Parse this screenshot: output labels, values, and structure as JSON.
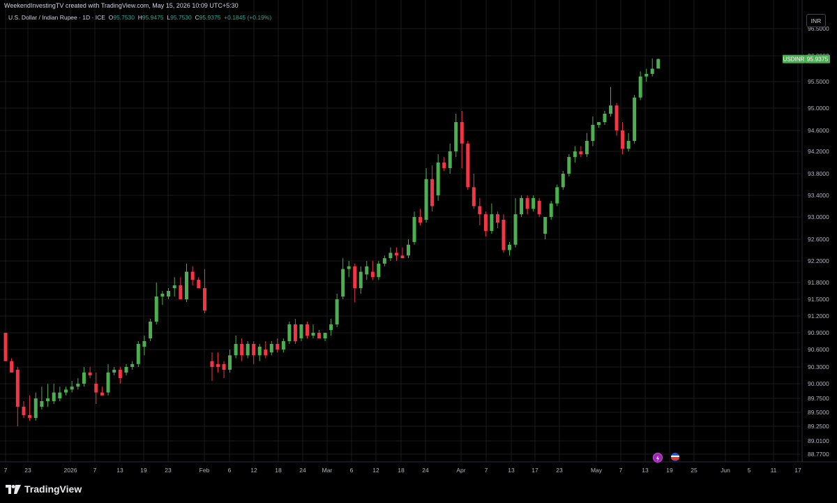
{
  "credit": "WeekendInvestingTV created with TradingView.com, May 15, 2026 10:09 UTC+5:30",
  "legend": {
    "symbol": "U.S. Dollar / Indian Rupee · 1D · ICE",
    "o_label": "O",
    "o": "95.7530",
    "h_label": "H",
    "h": "95.9475",
    "l_label": "L",
    "l": "95.7530",
    "c_label": "C",
    "c": "95.9375",
    "change": "+0.1845 (+0.19%)"
  },
  "currency_button": "INR",
  "brand": "TradingView",
  "colors": {
    "up": "#22ab94",
    "up_fill": "#4caf50",
    "down": "#f23645",
    "grid": "#1a1a1a",
    "axis_text": "#b2b5be",
    "price_tag": "#4caf50"
  },
  "event_icons": [
    "lightning-icon",
    "flag-icon"
  ],
  "chart_data": {
    "type": "candlestick",
    "symbol_tag": "USDINR",
    "last_price": "95.9375",
    "y_ticks": [
      "96.5000",
      "96.0000",
      "95.5000",
      "95.0000",
      "94.6000",
      "94.2000",
      "93.8000",
      "93.4000",
      "93.0000",
      "92.6000",
      "92.2000",
      "91.8000",
      "91.5000",
      "91.2000",
      "90.9000",
      "90.6000",
      "90.3000",
      "90.0000",
      "89.7500",
      "89.5000",
      "89.2500",
      "89.0100",
      "88.7700"
    ],
    "x_ticks": [
      "7",
      "23",
      "2026",
      "7",
      "13",
      "19",
      "23",
      "Feb",
      "6",
      "12",
      "18",
      "24",
      "Mar",
      "6",
      "12",
      "18",
      "24",
      "Apr",
      "7",
      "13",
      "17",
      "23",
      "May",
      "7",
      "13",
      "19",
      "25",
      "Jun",
      "5",
      "11",
      "17"
    ],
    "candles": [
      [
        90.9,
        90.9,
        90.4,
        90.4
      ],
      [
        90.4,
        90.45,
        90.2,
        90.2
      ],
      [
        90.25,
        90.3,
        89.25,
        89.6
      ],
      [
        89.6,
        89.7,
        89.4,
        89.45
      ],
      [
        89.45,
        89.8,
        89.35,
        89.4
      ],
      [
        89.4,
        89.85,
        89.35,
        89.75
      ],
      [
        89.6,
        89.95,
        89.55,
        89.7
      ],
      [
        89.7,
        90.0,
        89.6,
        89.75
      ],
      [
        89.7,
        90.0,
        89.65,
        89.85
      ],
      [
        89.75,
        89.95,
        89.7,
        89.85
      ],
      [
        89.85,
        89.95,
        89.8,
        89.9
      ],
      [
        89.9,
        90.05,
        89.85,
        89.95
      ],
      [
        89.95,
        90.1,
        89.9,
        90.0
      ],
      [
        90.0,
        90.3,
        89.95,
        90.2
      ],
      [
        90.2,
        90.3,
        90.1,
        90.15
      ],
      [
        90.0,
        90.2,
        89.65,
        89.85
      ],
      [
        89.85,
        89.95,
        89.8,
        89.8
      ],
      [
        89.85,
        90.35,
        89.8,
        90.2
      ],
      [
        90.2,
        90.3,
        90.15,
        90.25
      ],
      [
        90.25,
        90.3,
        90.0,
        90.1
      ],
      [
        90.2,
        90.35,
        90.15,
        90.3
      ],
      [
        90.3,
        90.4,
        90.25,
        90.35
      ],
      [
        90.35,
        90.75,
        90.3,
        90.7
      ],
      [
        90.65,
        90.85,
        90.5,
        90.75
      ],
      [
        90.8,
        91.15,
        90.75,
        91.1
      ],
      [
        91.1,
        91.8,
        91.05,
        91.55
      ],
      [
        91.55,
        91.65,
        91.4,
        91.6
      ],
      [
        91.55,
        91.7,
        91.5,
        91.65
      ],
      [
        91.7,
        91.9,
        91.55,
        91.75
      ],
      [
        91.75,
        91.9,
        91.6,
        91.5
      ],
      [
        91.5,
        92.15,
        91.45,
        92.0
      ],
      [
        92.0,
        92.1,
        91.75,
        91.85
      ],
      [
        91.85,
        91.9,
        91.7,
        91.7
      ],
      [
        91.7,
        92.05,
        91.25,
        91.3
      ],
      [
        90.4,
        90.55,
        90.05,
        90.3
      ],
      [
        90.35,
        90.55,
        90.2,
        90.3
      ],
      [
        90.35,
        90.4,
        90.1,
        90.25
      ],
      [
        90.25,
        90.6,
        90.2,
        90.5
      ],
      [
        90.5,
        90.85,
        90.45,
        90.7
      ],
      [
        90.7,
        90.8,
        90.4,
        90.5
      ],
      [
        90.5,
        90.75,
        90.45,
        90.7
      ],
      [
        90.7,
        90.75,
        90.35,
        90.5
      ],
      [
        90.5,
        90.7,
        90.4,
        90.65
      ],
      [
        90.6,
        90.75,
        90.45,
        90.5
      ],
      [
        90.55,
        90.75,
        90.5,
        90.7
      ],
      [
        90.7,
        90.8,
        90.55,
        90.6
      ],
      [
        90.6,
        90.8,
        90.55,
        90.75
      ],
      [
        90.75,
        91.1,
        90.7,
        91.05
      ],
      [
        91.05,
        91.15,
        90.7,
        90.75
      ],
      [
        90.8,
        91.05,
        90.75,
        91.05
      ],
      [
        91.05,
        91.1,
        90.8,
        90.85
      ],
      [
        90.85,
        91.05,
        90.8,
        90.9
      ],
      [
        90.9,
        90.95,
        90.8,
        90.8
      ],
      [
        90.8,
        90.9,
        90.75,
        90.9
      ],
      [
        90.95,
        91.15,
        90.85,
        91.05
      ],
      [
        91.05,
        91.6,
        91.0,
        91.5
      ],
      [
        91.55,
        92.25,
        91.5,
        92.05
      ],
      [
        92.05,
        92.2,
        91.9,
        92.1
      ],
      [
        92.1,
        92.15,
        91.45,
        91.7
      ],
      [
        91.7,
        92.1,
        91.6,
        92.0
      ],
      [
        91.95,
        92.2,
        91.85,
        92.1
      ],
      [
        92.0,
        92.2,
        91.85,
        91.9
      ],
      [
        91.9,
        92.2,
        91.85,
        92.15
      ],
      [
        92.15,
        92.3,
        92.1,
        92.25
      ],
      [
        92.25,
        92.45,
        92.2,
        92.35
      ],
      [
        92.35,
        92.45,
        92.2,
        92.3
      ],
      [
        92.3,
        92.45,
        92.25,
        92.25
      ],
      [
        92.3,
        92.6,
        92.25,
        92.5
      ],
      [
        92.55,
        93.1,
        92.5,
        93.0
      ],
      [
        93.0,
        93.15,
        92.85,
        92.9
      ],
      [
        92.95,
        93.9,
        92.9,
        93.7
      ],
      [
        93.7,
        93.95,
        93.1,
        93.2
      ],
      [
        93.4,
        94.15,
        93.3,
        94.0
      ],
      [
        94.0,
        94.1,
        93.85,
        93.9
      ],
      [
        93.9,
        94.35,
        93.8,
        94.2
      ],
      [
        94.2,
        94.9,
        94.1,
        94.75
      ],
      [
        94.75,
        94.95,
        93.9,
        94.35
      ],
      [
        94.35,
        94.4,
        93.5,
        93.55
      ],
      [
        93.55,
        93.8,
        93.15,
        93.2
      ],
      [
        93.2,
        93.35,
        92.85,
        93.05
      ],
      [
        93.05,
        93.1,
        92.65,
        92.75
      ],
      [
        92.75,
        93.25,
        92.7,
        93.05
      ],
      [
        93.05,
        93.1,
        92.8,
        92.9
      ],
      [
        92.95,
        93.05,
        92.35,
        92.4
      ],
      [
        92.4,
        92.55,
        92.3,
        92.5
      ],
      [
        92.5,
        93.35,
        92.45,
        93.05
      ],
      [
        93.05,
        93.4,
        93.0,
        93.35
      ],
      [
        93.35,
        93.4,
        93.05,
        93.15
      ],
      [
        93.15,
        93.4,
        93.1,
        93.35
      ],
      [
        93.3,
        93.35,
        93.0,
        93.05
      ],
      [
        92.7,
        93.0,
        92.6,
        93.0
      ],
      [
        93.0,
        93.3,
        92.95,
        93.25
      ],
      [
        93.25,
        93.6,
        93.2,
        93.55
      ],
      [
        93.55,
        93.85,
        93.5,
        93.8
      ],
      [
        93.8,
        94.15,
        93.75,
        94.1
      ],
      [
        94.1,
        94.3,
        94.0,
        94.2
      ],
      [
        94.2,
        94.3,
        94.1,
        94.15
      ],
      [
        94.15,
        94.55,
        94.1,
        94.4
      ],
      [
        94.4,
        94.85,
        94.3,
        94.7
      ],
      [
        94.7,
        94.75,
        94.65,
        94.75
      ],
      [
        94.75,
        94.95,
        94.7,
        94.9
      ],
      [
        94.9,
        95.4,
        94.85,
        95.05
      ],
      [
        95.05,
        95.1,
        94.5,
        94.6
      ],
      [
        94.6,
        94.75,
        94.15,
        94.25
      ],
      [
        94.25,
        94.55,
        94.2,
        94.4
      ],
      [
        94.4,
        95.25,
        94.35,
        95.2
      ],
      [
        95.2,
        95.7,
        95.15,
        95.6
      ],
      [
        95.6,
        95.75,
        95.5,
        95.65
      ],
      [
        95.65,
        95.95,
        95.6,
        95.75
      ],
      [
        95.753,
        95.9475,
        95.753,
        95.9375
      ]
    ]
  }
}
